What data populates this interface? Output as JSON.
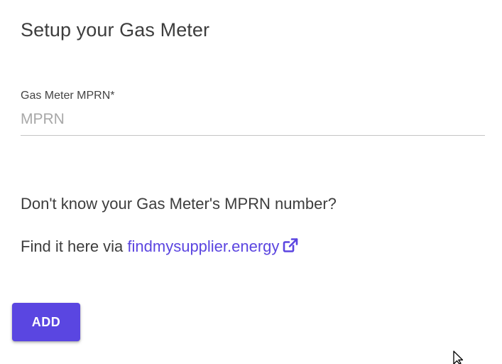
{
  "page": {
    "title": "Setup your Gas Meter"
  },
  "form": {
    "mprn_label": "Gas Meter MPRN*",
    "mprn_value": "",
    "mprn_placeholder": "MPRN"
  },
  "help": {
    "question": "Don't know your Gas Meter's MPRN number?",
    "find_prefix": "Find it here via ",
    "link_text": "findmysupplier.energy",
    "link_icon": "external-link-icon"
  },
  "actions": {
    "add_label": "ADD"
  },
  "colors": {
    "accent": "#5a46e1",
    "link": "#5b45e0",
    "text": "#3d3d3d",
    "placeholder": "#a8a8a8"
  }
}
